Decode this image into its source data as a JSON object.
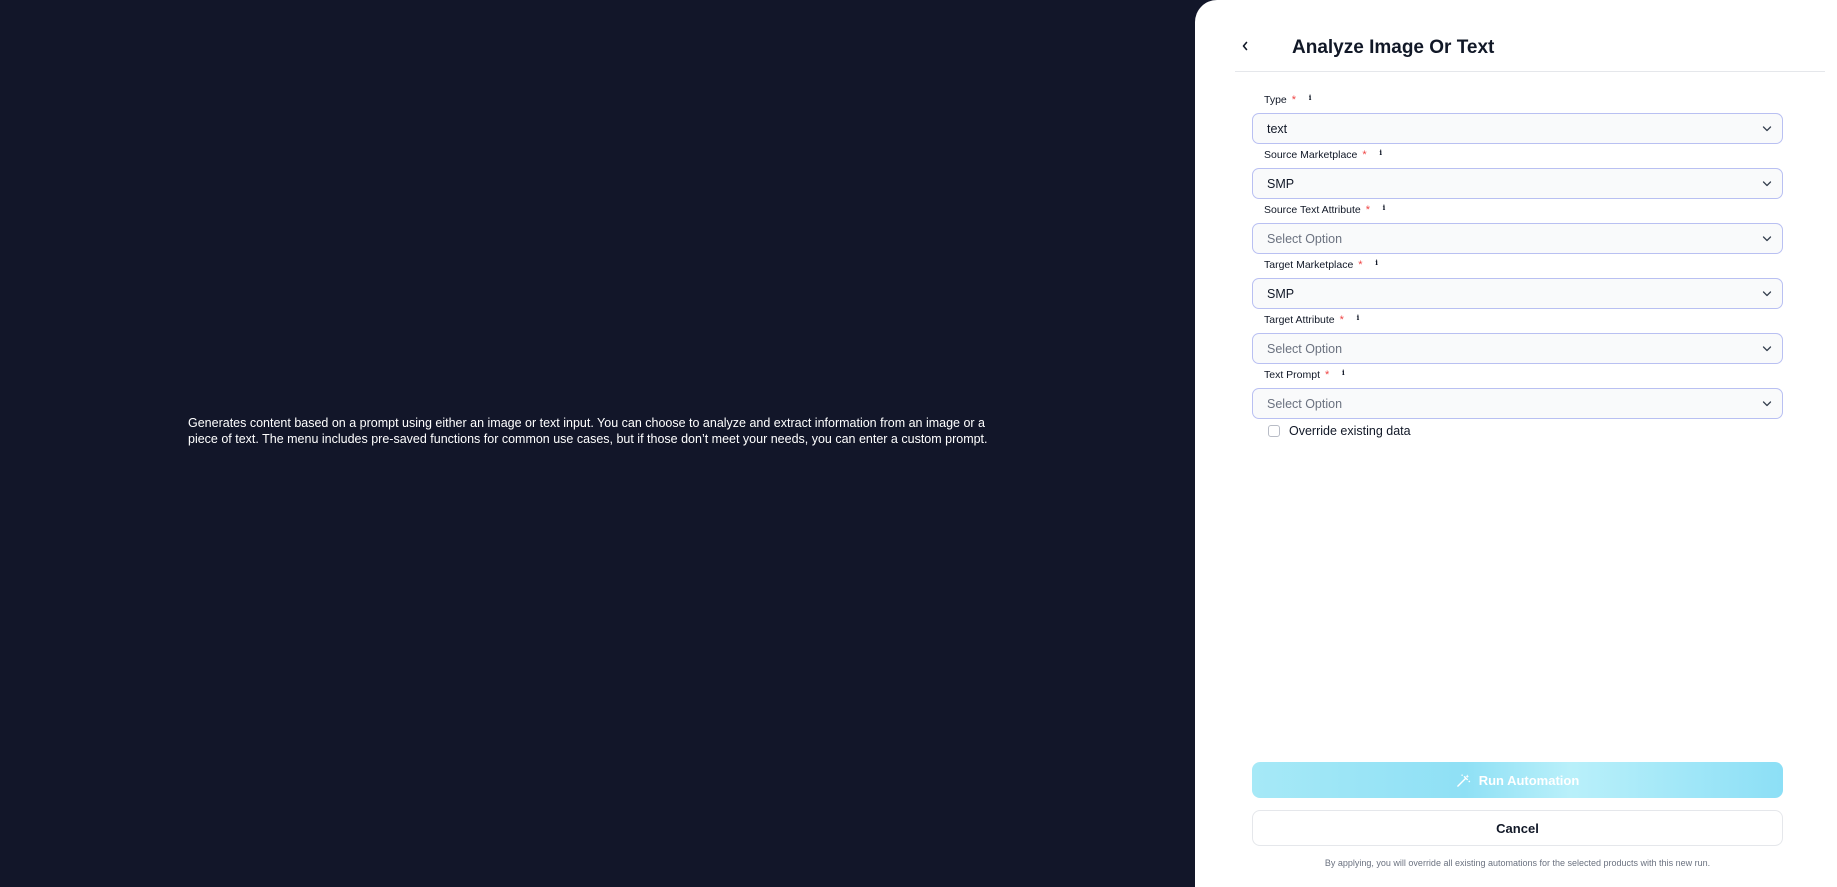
{
  "description": "Generates content based on a prompt using either an image or text input. You can choose to analyze and extract information from an image or a piece of text. The menu includes pre-saved functions for common use cases, but if those don’t meet your needs, you can enter a custom prompt.",
  "panel": {
    "title": "Analyze Image Or Text",
    "required_marker": "*",
    "info_glyph": "i",
    "fields": [
      {
        "label": "Type",
        "value": "text",
        "is_placeholder": false
      },
      {
        "label": "Source Marketplace",
        "value": "SMP",
        "is_placeholder": false
      },
      {
        "label": "Source Text Attribute",
        "value": "Select Option",
        "is_placeholder": true
      },
      {
        "label": "Target Marketplace",
        "value": "SMP",
        "is_placeholder": false
      },
      {
        "label": "Target Attribute",
        "value": "Select Option",
        "is_placeholder": true
      },
      {
        "label": "Text Prompt",
        "value": "Select Option",
        "is_placeholder": true
      }
    ],
    "override_label": "Override existing data",
    "override_checked": false,
    "run_label": "Run Automation",
    "cancel_label": "Cancel",
    "disclaimer": "By applying, you will override all existing automations for the selected products with this new run."
  },
  "colors": {
    "backdrop": "#121629",
    "required": "#ef4444",
    "select_border": "#b9c0f2",
    "run_button": "#8fe0f5"
  }
}
